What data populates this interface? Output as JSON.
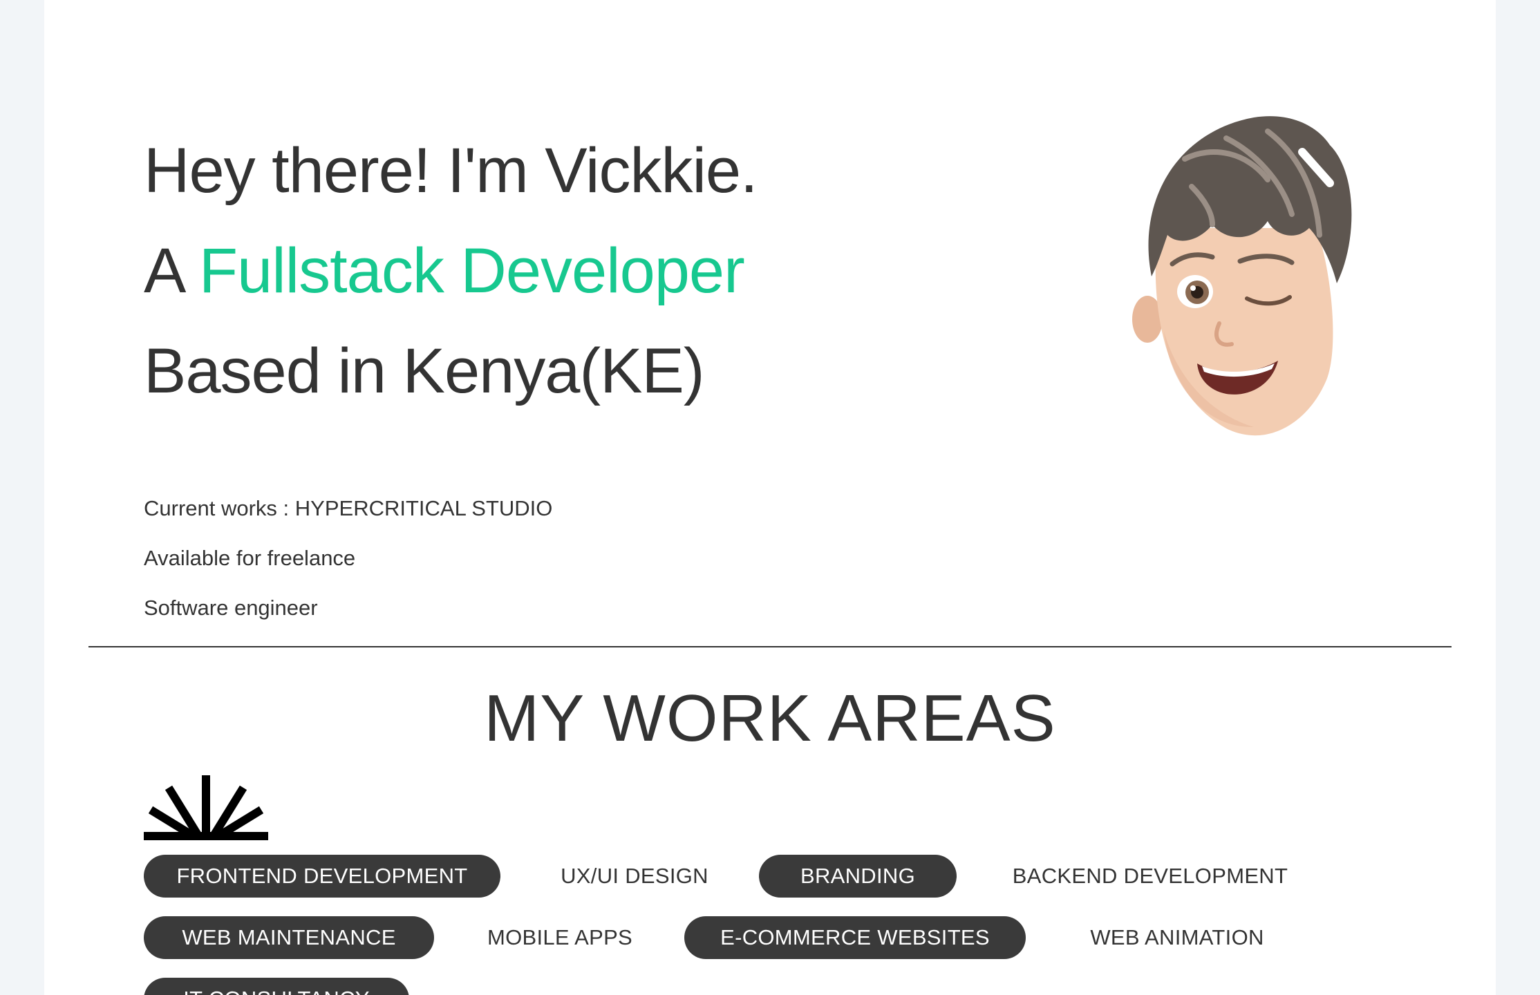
{
  "hero": {
    "line1": "Hey there! I'm Vickkie.",
    "line2_prefix": "A ",
    "line2_accent": "Fullstack Developer",
    "line3": "Based in Kenya(KE)"
  },
  "info": {
    "current_works": "Current works : HYPERCRITICAL STUDIO",
    "availability": "Available for freelance",
    "role": "Software engineer"
  },
  "work_areas": {
    "title": "MY WORK AREAS",
    "tags": [
      {
        "label": "FRONTEND DEVELOPMENT",
        "filled": true
      },
      {
        "label": "UX/UI DESIGN",
        "filled": false
      },
      {
        "label": "BRANDING",
        "filled": true
      },
      {
        "label": "BACKEND DEVELOPMENT",
        "filled": false
      },
      {
        "label": "WEB MAINTENANCE",
        "filled": true
      },
      {
        "label": "MOBILE APPS",
        "filled": false
      },
      {
        "label": "E-COMMERCE WEBSITES",
        "filled": true
      },
      {
        "label": "WEB ANIMATION",
        "filled": false
      },
      {
        "label": "IT CONSULTANCY",
        "filled": true
      }
    ]
  },
  "icons": {
    "avatar": "winking-memoji-avatar",
    "burst": "sunburst-icon"
  },
  "colors": {
    "accent": "#17c88f",
    "text": "#333333",
    "tag_fill": "#3a3a3a",
    "page_bg": "#ffffff",
    "outer_bg": "#f2f5f8"
  }
}
